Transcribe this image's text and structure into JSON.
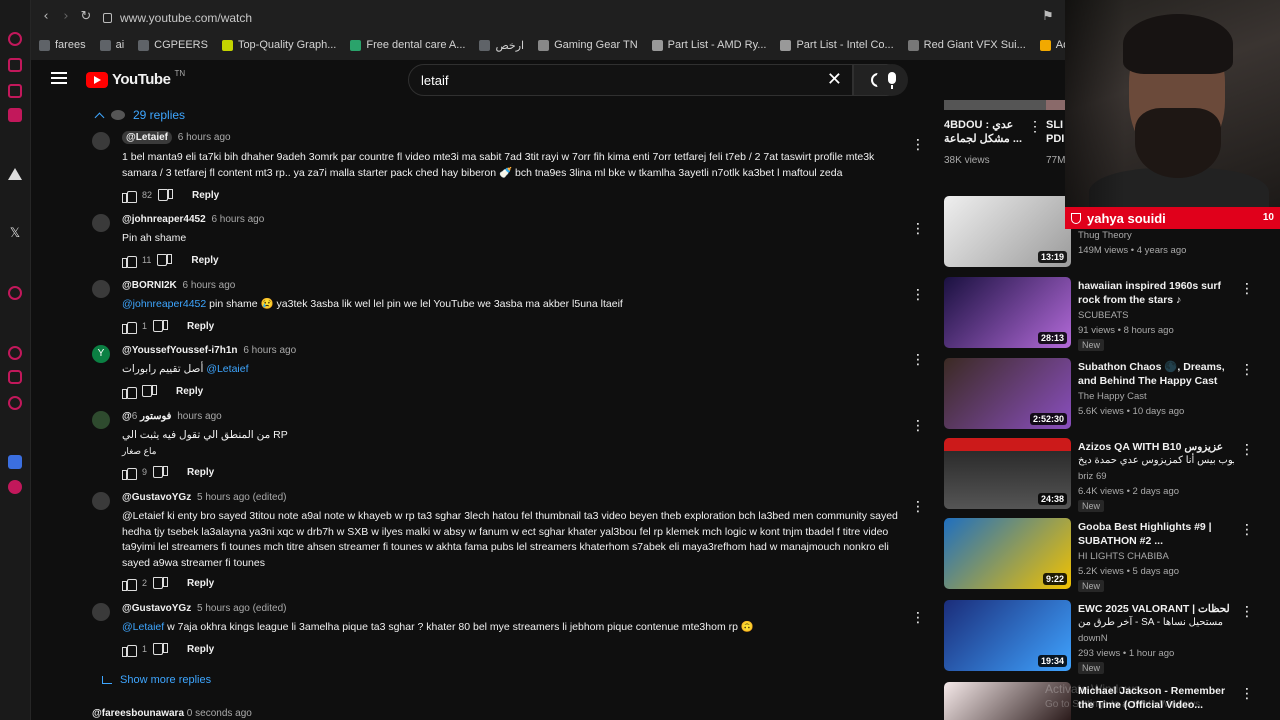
{
  "browser": {
    "url": "www.youtube.com/watch",
    "bookmarks": [
      {
        "label": "farees",
        "color": "#5f6368"
      },
      {
        "label": "ai",
        "color": "#5f6368"
      },
      {
        "label": "CGPEERS",
        "color": "#5f6368"
      },
      {
        "label": "Top-Quality Graph...",
        "color": "#c3d400"
      },
      {
        "label": "Free dental care A...",
        "color": "#2aa36b"
      },
      {
        "label": "ارخص",
        "color": "#5f6368"
      },
      {
        "label": "Gaming Gear TN",
        "color": "#888888"
      },
      {
        "label": "Part List - AMD Ry...",
        "color": "#999999"
      },
      {
        "label": "Part List - Intel Co...",
        "color": "#999999"
      },
      {
        "label": "Red Giant VFX Sui...",
        "color": "#777777"
      },
      {
        "label": "AddMeFast - FB P...",
        "color": "#f2a900"
      }
    ]
  },
  "youtube": {
    "logo_text": "YouTube",
    "logo_region": "TN",
    "search_value": "letaif"
  },
  "comments": {
    "replies_label": "29 replies",
    "items": [
      {
        "author": "@Letaief",
        "chip": true,
        "time": "6 hours ago",
        "mention": "",
        "text": "1 bel manta9 eli ta7ki bih dhaher 9adeh 3omrk par countre fl video mte3i ma sabit 7ad 3tit rayi w 7orr fih kima enti 7orr tetfarej feli t7eb / 2 7at taswirt profile mte3k samara / 3 tetfarej fl content mt3 rp.. ya za7i malla starter pack ched hay biberon 🍼 bch tna9es 3lina ml bke w tkamlha 3ayetli n7otlk ka3bet l maftoul zeda",
        "likes": "82"
      },
      {
        "author": "@johnreaper4452",
        "chip": false,
        "time": "6 hours ago",
        "mention": "",
        "text": "Pin ah shame",
        "likes": "11"
      },
      {
        "author": "@BORNI2K",
        "chip": false,
        "time": "6 hours ago",
        "mention": "@johnreaper4452",
        "text": "pin shame 😢 ya3tek 3asba lik wel lel pin we lel YouTube we 3asba ma akber l5una ltaeif",
        "likes": "1"
      },
      {
        "author": "@YoussefYoussef-i7h1n",
        "chip": false,
        "time": "6 hours ago",
        "mention": "@Letaief",
        "text": "أصل تقييم رابورات",
        "likes": ""
      },
      {
        "author": "@فوستور",
        "chip": false,
        "time": "6 hours ago",
        "mention": "",
        "text": "من المنطق الي تقول فيه يثبت الي RP",
        "text2": "ماع صغار",
        "likes": "9"
      },
      {
        "author": "@GustavoYGz",
        "chip": false,
        "time": "5 hours ago (edited)",
        "mention": "",
        "text": "@Letaief  ki enty bro sayed 3titou note a9al note w khayeb w rp ta3 sghar 3lech hatou fel thumbnail ta3 video beyen theb exploration bch la3bed men community sayed hedha tjy tsebek la3alayna ya3ni xqc w drb7h w SXB w ilyes malki w absy w fanum w ect sghar khater yal3bou fel rp klemek mch logic w kont tnjm tbadel f titre video ta9yimi lel streamers fi tounes mch titre ahsen streamer fi tounes w akhta fama pubs lel streamers khaterhom s7abek eli maya3refhom had w manajmouch nonkro eli sayed a9wa streamer fi tounes",
        "likes": "2"
      },
      {
        "author": "@GustavoYGz",
        "chip": false,
        "time": "5 hours ago (edited)",
        "mention": "@Letaief",
        "text": "w 7aja okhra kings league li 3amelha pique ta3 sghar ? khater 80 bel mye streamers  li jebhom pique contenue mte3hom rp 🙃",
        "likes": "1"
      }
    ],
    "show_more": "Show more replies",
    "last_author": "@fareesbounawara",
    "last_time": "0 seconds ago",
    "reply_label": "Reply"
  },
  "related": {
    "top": {
      "title": "4BDOU : عدي مشكل لجماعة ...",
      "views": "38K views",
      "title2": "SLI PDI",
      "views2": "77M"
    },
    "items": [
      {
        "title": "",
        "channel": "Thug Theory",
        "meta": "149M views • 4 years ago",
        "duration": "13:19",
        "new": false,
        "colors": [
          "#e9e9e9",
          "#9b9b9b"
        ]
      },
      {
        "title": "hawaiian inspired 1960s surf rock from the stars ♪",
        "channel": "SCUBEATS",
        "meta": "91 views • 8 hours ago",
        "duration": "28:13",
        "new": true,
        "colors": [
          "#1a1140",
          "#b36ad9"
        ]
      },
      {
        "title": "Subathon Chaos 🌑, Dreams, and Behind The Happy Cast 🎙...",
        "channel": "The Happy Cast",
        "meta": "5.6K views • 10 days ago",
        "duration": "2:52:30",
        "new": false,
        "colors": [
          "#3b2a23",
          "#8a4fbf"
        ]
      },
      {
        "title": "Azizos QA WITH B10 عزيزوس",
        "title_line2": "يوب بيس أنا كمزيزوس عدي حمدة ديخ...",
        "channel": "briz 69",
        "meta": "6.4K views • 2 days ago",
        "duration": "24:38",
        "new": true,
        "colors": [
          "#cc1a1a",
          "#2b2b2b"
        ]
      },
      {
        "title": "Gooba Best Highlights #9 | SUBATHON #2 ...",
        "channel": "HI LIGHTS CHABIBA",
        "meta": "5.2K views • 5 days ago",
        "duration": "9:22",
        "new": true,
        "colors": [
          "#1f6fbf",
          "#f2c200"
        ]
      },
      {
        "title": "EWC 2025 VALORANT | لحظات",
        "title_line2": "آخر طرق من - SA - مستحيل نساها",
        "channel": "downN",
        "meta": "293 views • 1 hour ago",
        "duration": "19:34",
        "new": true,
        "colors": [
          "#1b2d7a",
          "#3fa3ff"
        ]
      },
      {
        "title": "Michael Jackson - Remember the Time (Official Video...",
        "channel": "",
        "meta": "",
        "duration": "",
        "new": false,
        "colors": [
          "#f5e9e9",
          "#2b1b1b"
        ]
      }
    ]
  },
  "overlay": {
    "donation_name": "yahya souidi",
    "donation_count": "10",
    "watermark_1": "Activate Windows",
    "watermark_2": "Go to Settings to activate Windows."
  }
}
